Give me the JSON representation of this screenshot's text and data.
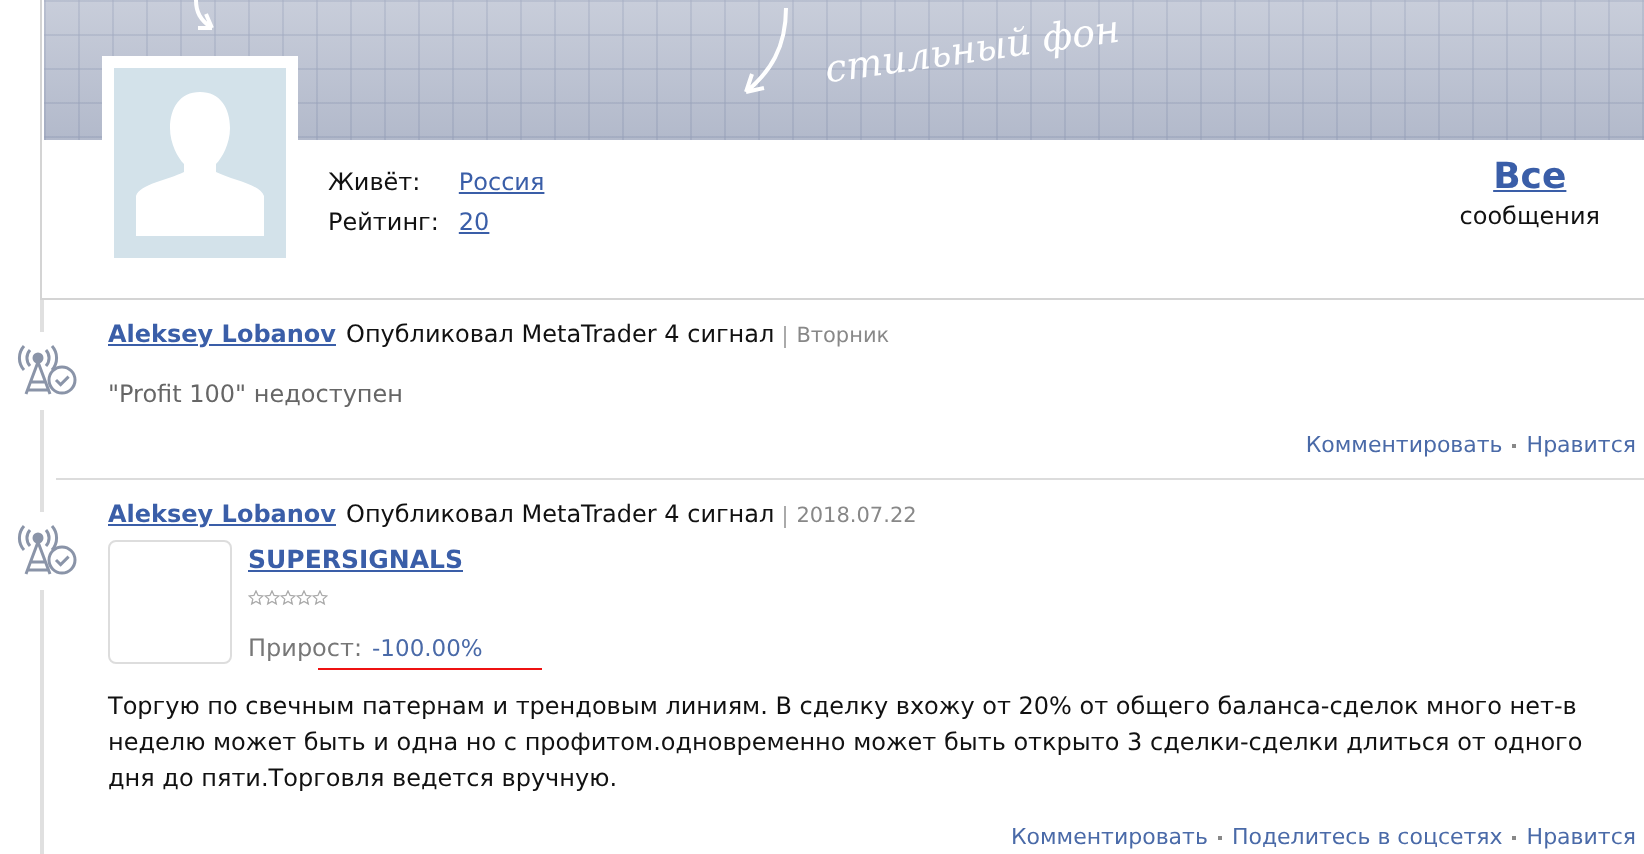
{
  "banner": {
    "caption": "стильный фон"
  },
  "profile": {
    "fields": [
      {
        "label": "Живёт:",
        "value": "Россия"
      },
      {
        "label": "Рейтинг:",
        "value": "20"
      }
    ],
    "messages_link": "Все",
    "messages_label": "сообщения"
  },
  "feed": [
    {
      "kind": "unavailable",
      "author": "Aleksey Lobanov",
      "action": "Опубликовал MetaTrader 4 сигнал",
      "date": "Вторник",
      "text": "\"Profit 100\" недоступен",
      "actions": [
        "Комментировать",
        "Нравится"
      ]
    },
    {
      "kind": "signal",
      "author": "Aleksey Lobanov",
      "action": "Опубликовал MetaTrader 4 сигнал",
      "date": "2018.07.22",
      "signal": {
        "title": "SUPERSIGNALS",
        "stars": 0,
        "growth_label": "Прирост:",
        "growth_value": "-100.00%"
      },
      "text": "Торгую по свечным патернам и трендовым линиям. В сделку вхожу от 20% от общего баланса-сделок много нет-в неделю может быть и одна но с профитом.одновременно может быть открыто 3 сделки-сделки длиться от одного дня до пяти.Торговля ведется вручную.",
      "actions": [
        "Комментировать",
        "Поделитесь в соцсетях",
        "Нравится"
      ]
    }
  ]
}
